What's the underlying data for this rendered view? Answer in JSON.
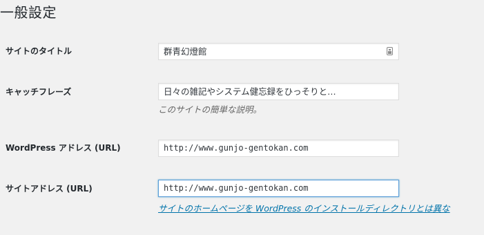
{
  "page": {
    "title": "一般設定"
  },
  "settings": {
    "site_title": {
      "label": "サイトのタイトル",
      "value": "群青幻燈館",
      "icon": "contact-card-icon"
    },
    "tagline": {
      "label": "キャッチフレーズ",
      "value": "日々の雑記やシステム健忘録をひっそりと…",
      "description": "このサイトの簡単な説明。"
    },
    "wordpress_address": {
      "label": "WordPress アドレス (URL)",
      "value": "http://www.gunjo-gentokan.com"
    },
    "site_address": {
      "label": "サイトアドレス (URL)",
      "value": "http://www.gunjo-gentokan.com",
      "description_link": "サイトのホームページを WordPress のインストールディレクトリとは異な"
    }
  },
  "colors": {
    "background": "#f1f1f1",
    "text": "#23282d",
    "link": "#0073aa",
    "focus_border": "#5b9dd9",
    "description": "#666666"
  }
}
